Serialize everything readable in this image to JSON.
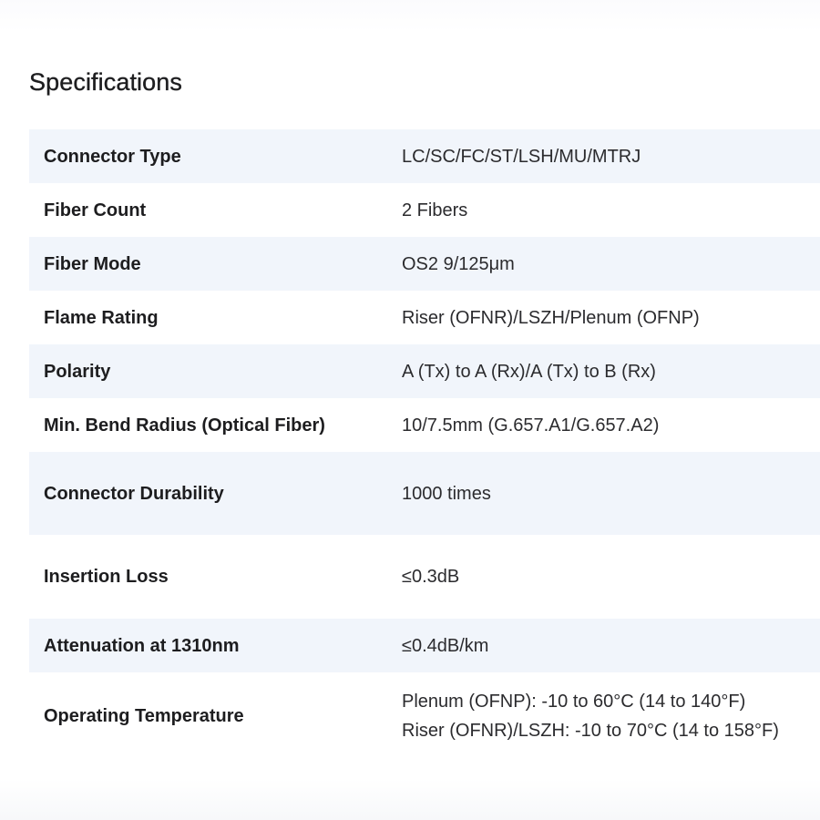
{
  "section": {
    "title": "Specifications"
  },
  "specs": [
    {
      "label": "Connector Type",
      "value": "LC/SC/FC/ST/LSH/MU/MTRJ"
    },
    {
      "label": "Fiber Count",
      "value": "2 Fibers"
    },
    {
      "label": "Fiber Mode",
      "value": "OS2 9/125μm"
    },
    {
      "label": "Flame Rating",
      "value": "Riser (OFNR)/LSZH/Plenum (OFNP)"
    },
    {
      "label": "Polarity",
      "value": "A (Tx) to A (Rx)/A (Tx) to B (Rx)"
    },
    {
      "label": "Min. Bend Radius (Optical Fiber)",
      "value": "10/7.5mm (G.657.A1/G.657.A2)"
    },
    {
      "label": "Connector Durability",
      "value": "1000 times"
    },
    {
      "label": "Insertion Loss",
      "value": "≤0.3dB"
    },
    {
      "label": "Attenuation at 1310nm",
      "value": "≤0.4dB/km"
    },
    {
      "label": "Operating Temperature",
      "values": [
        "Plenum (OFNP): -10 to 60°C (14 to 140°F)",
        "Riser (OFNR)/LSZH: -10 to 70°C (14 to 158°F)"
      ]
    }
  ]
}
